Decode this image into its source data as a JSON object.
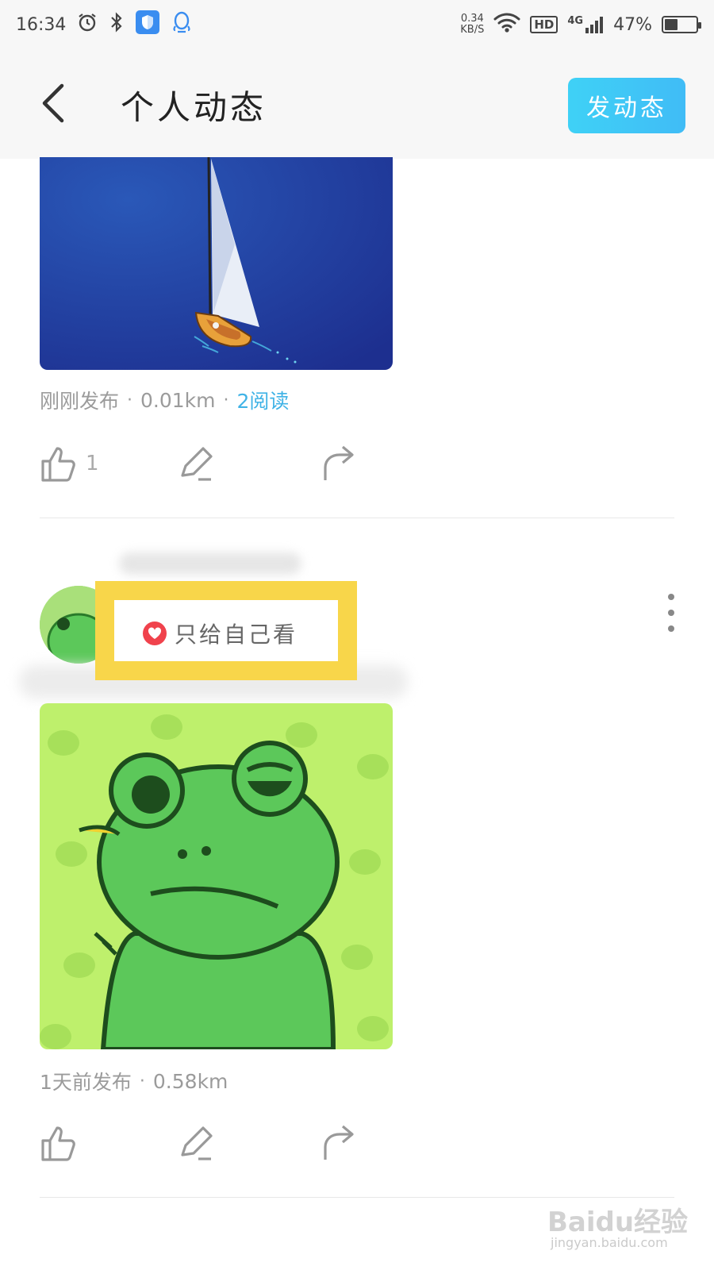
{
  "status_bar": {
    "time": "16:34",
    "net_speed_value": "0.34",
    "net_speed_unit": "KB/S",
    "hd_label": "HD",
    "network_type": "4G",
    "battery_percent": "47%",
    "battery_level": 0.47
  },
  "header": {
    "title": "个人动态",
    "post_button_label": "发动态",
    "accent_color": "#40c8f6"
  },
  "posts": [
    {
      "time": "刚刚发布",
      "distance": "0.01km",
      "reads": "2阅读",
      "like_count": "1",
      "image": "sailboat-image"
    },
    {
      "privacy_label": "只给自己看",
      "time": "1天前发布",
      "distance": "0.58km",
      "image": "frog-image"
    }
  ],
  "separator_dot": "·",
  "watermark": {
    "text": "Baidu经验",
    "sub": "jingyan.baidu.com"
  }
}
